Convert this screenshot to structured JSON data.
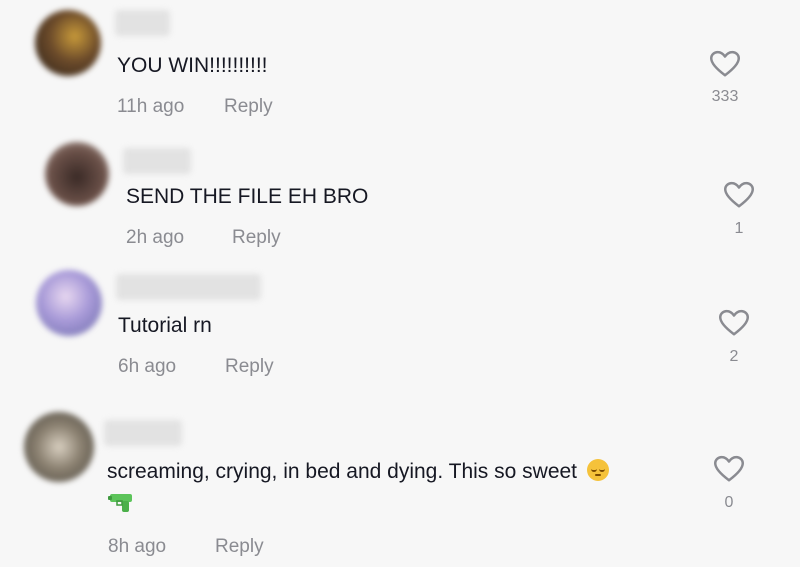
{
  "comments": [
    {
      "text": "YOU WIN!!!!!!!!!!",
      "time": "11h ago",
      "reply_label": "Reply",
      "likes": "333",
      "avatar_color": "#5a4030"
    },
    {
      "text": "SEND THE FILE EH BRO",
      "time": "2h ago",
      "reply_label": "Reply",
      "likes": "1",
      "avatar_color": "#4a3a34"
    },
    {
      "text": "Tutorial rn",
      "time": "6h ago",
      "reply_label": "Reply",
      "likes": "2",
      "avatar_color": "#9a92c8"
    },
    {
      "text": "screaming, crying, in bed and dying. This so sweet",
      "emoji": "relieved-face",
      "second_line_emoji": "water-pistol",
      "time": "8h ago",
      "reply_label": "Reply",
      "likes": "0",
      "avatar_color": "#6f6a5e"
    }
  ],
  "icons": {
    "like": "heart-outline-icon"
  },
  "colors": {
    "background": "#f7f7f7",
    "text": "#161823",
    "muted": "#8a8b91"
  }
}
